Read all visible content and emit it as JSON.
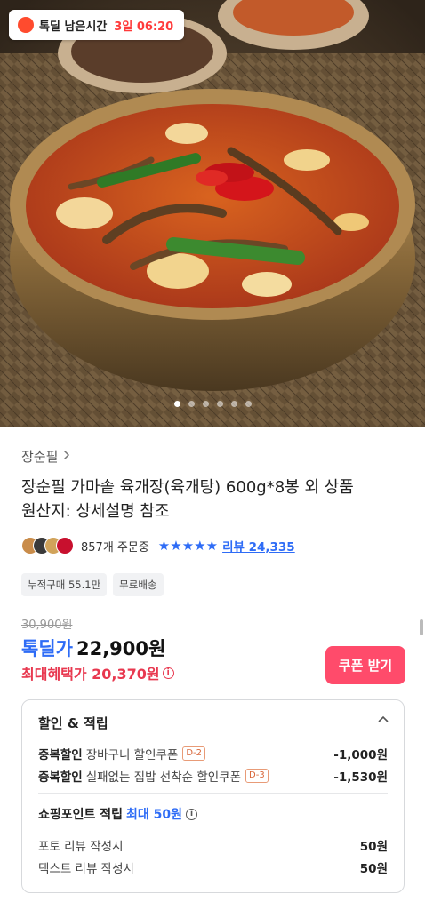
{
  "timer": {
    "label": "톡딜 남은시간",
    "value": "3일 06:20",
    "icon": "clock-icon"
  },
  "carousel": {
    "count": 6,
    "active_index": 0
  },
  "product": {
    "brand": "장순필",
    "title": "장순필 가마솥 육개장(육개탕) 600g*8봉 외 상품",
    "origin": "원산지: 상세설명 참조"
  },
  "stats": {
    "orders": "857개 주문중",
    "rating_stars": 5,
    "review_link": "리뷰 24,335"
  },
  "tags": [
    "누적구매 55.1만",
    "무료배송"
  ],
  "price": {
    "original": "30,900원",
    "deal_label": "톡딜가",
    "deal_price": "22,900원",
    "max_benefit": "최대혜택가 20,370원",
    "coupon_button": "쿠폰 받기"
  },
  "discount": {
    "header": "할인 & 적립",
    "rows": [
      {
        "kind": "중복할인",
        "desc": "장바구니 할인쿠폰",
        "badge": "D-2",
        "amount": "-1,000원"
      },
      {
        "kind": "중복할인",
        "desc": "실패없는 집밥 선착순 할인쿠폰",
        "badge": "D-3",
        "amount": "-1,530원"
      }
    ],
    "points": {
      "title": "쇼핑포인트 적립",
      "max": "최대 50원",
      "rows": [
        {
          "label": "포토 리뷰 작성시",
          "amount": "50원"
        },
        {
          "label": "텍스트 리뷰 작성시",
          "amount": "50원"
        }
      ]
    }
  },
  "colors": {
    "accent_blue": "#2e6cf6",
    "benefit_red": "#e8384f",
    "coupon_pink": "#ff4b6b"
  }
}
